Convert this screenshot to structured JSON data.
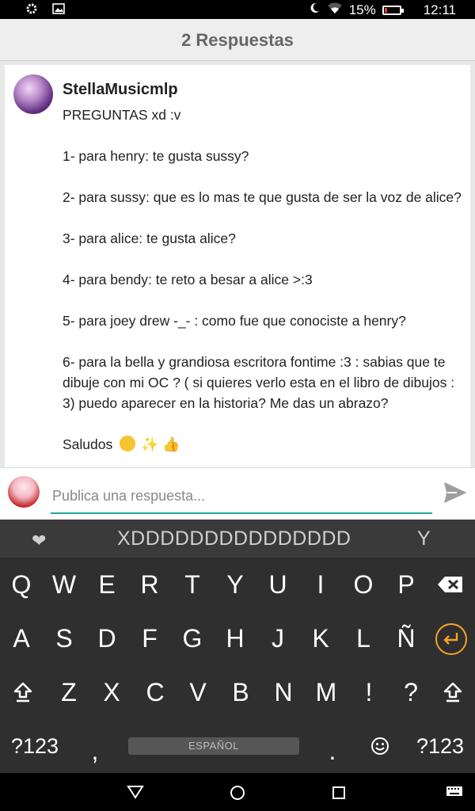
{
  "status_bar": {
    "battery_percent": "15%",
    "battery_level": 0.15,
    "time": "12:11",
    "icons": [
      "gear-icon",
      "image-icon",
      "moon-icon",
      "wifi-icon",
      "battery-icon"
    ]
  },
  "header": {
    "title": "2 Respuestas"
  },
  "comment": {
    "author": "StellaMusicmlp",
    "lines": [
      "PREGUNTAS xd :v",
      "1- para henry: te gusta sussy?",
      "2- para sussy: que es lo mas te que gusta de ser la voz de alice?",
      "3- para alice: te gusta alice?",
      "4- para bendy: te reto a besar a alice >:3",
      "5- para joey drew -_- : como fue que conociste a henry?",
      "6- para la bella y grandiosa escritora fontime :3 : sabias que te dibuje con mi OC ? ( si quieres verlo esta en el libro de dibujos : 3) puedo aparecer en la historia? Me das un abrazo?",
      "Saludos"
    ],
    "emojis": [
      "kiss-emoji",
      "sparkles-emoji",
      "thumbs-up-emoji"
    ]
  },
  "reply": {
    "placeholder": "Publica una respuesta..."
  },
  "keyboard": {
    "suggestions": [
      "XDDDDDDDDDDDDDDD",
      "Y"
    ],
    "row1": [
      "Q",
      "W",
      "E",
      "R",
      "T",
      "Y",
      "U",
      "I",
      "O",
      "P"
    ],
    "row2": [
      "A",
      "S",
      "D",
      "F",
      "G",
      "H",
      "J",
      "K",
      "L",
      "Ñ"
    ],
    "row3": [
      "Z",
      "X",
      "C",
      "V",
      "B",
      "N",
      "M",
      "!",
      "?"
    ],
    "sym_label": "?123",
    "comma": ",",
    "period": ".",
    "space_label": "ESPAÑOL",
    "accent_color": "#f5a623"
  },
  "colors": {
    "input_underline": "#26a69a",
    "battery_low": "#e53935"
  }
}
